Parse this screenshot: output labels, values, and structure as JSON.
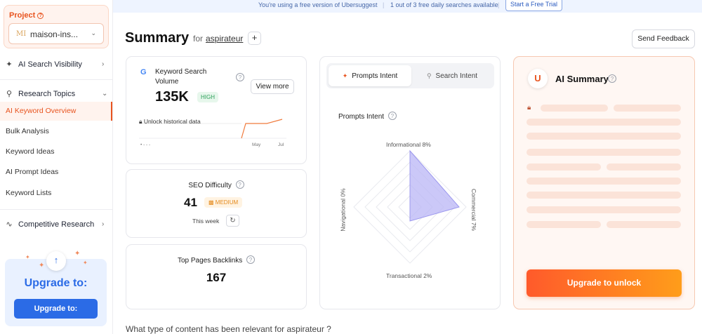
{
  "banner": {
    "message": "You're using a free version of Ubersuggest",
    "searches": "1 out of 3 free daily searches available",
    "trial_button": "Start a Free Trial"
  },
  "sidebar": {
    "project_label": "Project",
    "project_mark": "MI",
    "project_name": "maison-ins...",
    "ai_search_visibility": "AI Search Visibility",
    "research_topics": "Research Topics",
    "sub_items": [
      {
        "label": "AI Keyword Overview",
        "active": true
      },
      {
        "label": "Bulk Analysis",
        "active": false
      },
      {
        "label": "Keyword Ideas",
        "active": false
      },
      {
        "label": "AI Prompt Ideas",
        "active": false
      },
      {
        "label": "Keyword Lists",
        "active": false
      }
    ],
    "competitive_research": "Competitive Research",
    "upgrade_title": "Upgrade to:",
    "upgrade_button": "Upgrade to:"
  },
  "header": {
    "title": "Summary",
    "for_text": "for",
    "keyword": "aspirateur",
    "plus": "+",
    "feedback_button": "Send Feedback"
  },
  "ksv": {
    "label": "Keyword Search Volume",
    "value": "135K",
    "badge": "HIGH",
    "view_more": "View more",
    "unlock_text": "Unlock historical data",
    "x_labels": [
      "May",
      "Jul"
    ],
    "left_label": "• - - -"
  },
  "seo": {
    "label": "SEO Difficulty",
    "value": "41",
    "badge": "MEDIUM",
    "period": "This week"
  },
  "backlinks": {
    "label": "Top Pages Backlinks",
    "value": "167"
  },
  "intent": {
    "tab_prompts": "Prompts Intent",
    "tab_search": "Search Intent",
    "title": "Prompts Intent",
    "labels": {
      "informational": "Informational 8%",
      "commercial": "Commercial 7%",
      "transactional": "Transactional 2%",
      "navigational": "Navigational 0%"
    },
    "values": {
      "informational": 8,
      "commercial": 7,
      "transactional": 2,
      "navigational": 0
    }
  },
  "ai": {
    "title": "AI Summary",
    "logo": "U",
    "button": "Upgrade to unlock"
  },
  "bottom_question": "What type of content has been relevant for aspirateur ?",
  "colors": {
    "accent": "#e8541f",
    "blue": "#2b6be6",
    "radar_fill": "#b9b6f5"
  }
}
